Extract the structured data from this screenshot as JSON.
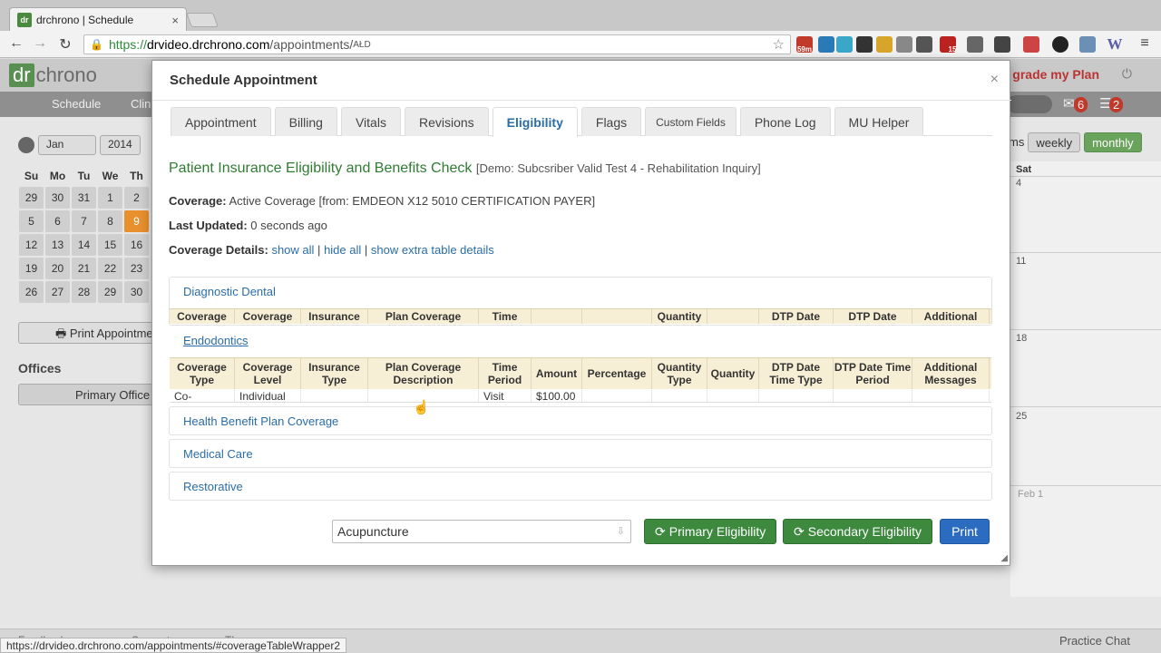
{
  "browser": {
    "tab_title": "drchrono | Schedule",
    "tab_favicon": "dr",
    "tab_close": "×",
    "url_https": "https://",
    "url_host": "drvideo.drchrono.com",
    "url_path": "/appointments/",
    "status_url": "https://drvideo.drchrono.com/appointments/#coverageTableWrapper2",
    "ext_badge_1": "59m",
    "ext_badge_2": "15",
    "ext_letter": "W",
    "ad_text": "AŁD"
  },
  "app": {
    "logo_dr": "dr",
    "logo_text": "chrono",
    "upgrade": "grade my Plan",
    "nav_schedule": "Schedule",
    "nav_clin": "Clin",
    "badge_msgs": "6",
    "badge_tasks": "2",
    "month": "Jan",
    "year": "2014",
    "weekdays": [
      "Su",
      "Mo",
      "Tu",
      "We",
      "Th"
    ],
    "cal_rows": [
      [
        "29",
        "30",
        "31",
        "1",
        "2"
      ],
      [
        "5",
        "6",
        "7",
        "8",
        "9"
      ],
      [
        "12",
        "13",
        "14",
        "15",
        "16"
      ],
      [
        "19",
        "20",
        "21",
        "22",
        "23"
      ],
      [
        "26",
        "27",
        "28",
        "29",
        "30"
      ]
    ],
    "print_appointments": "Print Appointme",
    "offices_heading": "Offices",
    "primary_office": "Primary Office",
    "view_partial": "ms",
    "view_weekly": "weekly",
    "view_monthly": "monthly",
    "sat_label": "Sat",
    "day_4": "4",
    "day_11": "11",
    "day_18": "18",
    "day_25": "25",
    "day_feb1": "Feb 1",
    "footer_feedback": "Feedback",
    "footer_support": "Support",
    "footer_theme": "Theme",
    "practice_chat": "Practice Chat"
  },
  "modal": {
    "title": "Schedule Appointment",
    "close": "×",
    "tabs": [
      "Appointment",
      "Billing",
      "Vitals",
      "Revisions",
      "Eligibility",
      "Flags",
      "Custom Fields",
      "Phone Log",
      "MU Helper"
    ],
    "active_tab": "Eligibility",
    "heading": "Patient Insurance Eligibility and Benefits Check",
    "heading_demo": "[Demo: Subcsriber Valid Test 4 - Rehabilitation Inquiry]",
    "coverage_label": "Coverage:",
    "coverage_value": "Active Coverage [from: EMDEON X12 5010 CERTIFICATION PAYER]",
    "updated_label": "Last Updated:",
    "updated_value": "0 seconds ago",
    "details_label": "Coverage Details:",
    "show_all": "show all",
    "hide_all": "hide all",
    "show_extra": "show extra table details",
    "sep": "|",
    "sections": {
      "dental": "Diagnostic Dental",
      "endo": "Endodontics",
      "hbp": "Health Benefit Plan Coverage",
      "medical": "Medical Care",
      "restorative": "Restorative"
    },
    "dental_headers": [
      "Coverage",
      "Coverage",
      "Insurance",
      "Plan Coverage",
      "Time",
      "",
      "",
      "Quantity",
      "",
      "DTP Date",
      "DTP Date",
      "Additional"
    ],
    "endo_headers": [
      "Coverage Type",
      "Coverage Level",
      "Insurance Type",
      "Plan Coverage Description",
      "Time Period",
      "Amount",
      "Percentage",
      "Quantity Type",
      "Quantity",
      "DTP Date Time Type",
      "DTP Date Time Period",
      "Additional Messages"
    ],
    "endo_row": [
      "Co-",
      "Individual",
      "",
      "",
      "Visit",
      "$100.00",
      "",
      "",
      "",
      "",
      "",
      ""
    ],
    "service_select": "Acupuncture",
    "btn_primary": "Primary Eligibility",
    "btn_secondary": "Secondary Eligibility",
    "btn_print": "Print"
  }
}
